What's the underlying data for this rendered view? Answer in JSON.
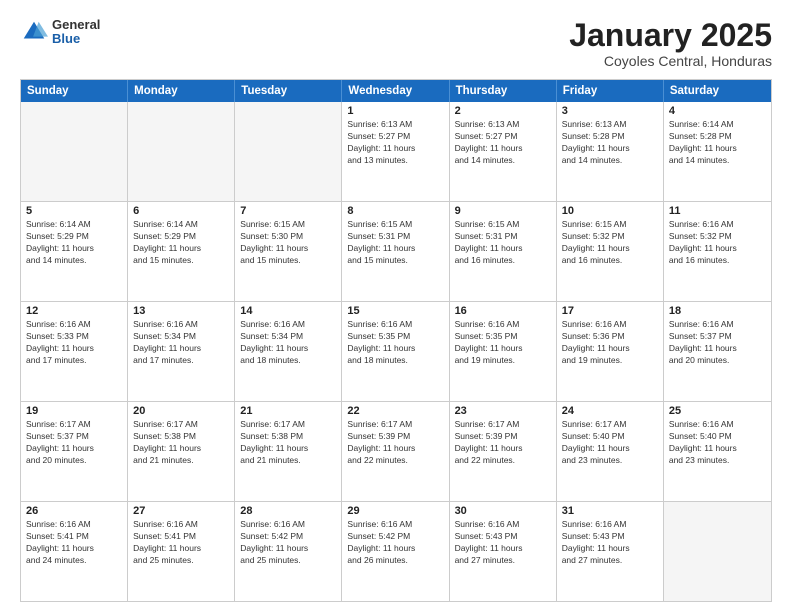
{
  "logo": {
    "general": "General",
    "blue": "Blue"
  },
  "title": "January 2025",
  "location": "Coyoles Central, Honduras",
  "days_of_week": [
    "Sunday",
    "Monday",
    "Tuesday",
    "Wednesday",
    "Thursday",
    "Friday",
    "Saturday"
  ],
  "weeks": [
    [
      {
        "day": "",
        "info": ""
      },
      {
        "day": "",
        "info": ""
      },
      {
        "day": "",
        "info": ""
      },
      {
        "day": "1",
        "info": "Sunrise: 6:13 AM\nSunset: 5:27 PM\nDaylight: 11 hours\nand 13 minutes."
      },
      {
        "day": "2",
        "info": "Sunrise: 6:13 AM\nSunset: 5:27 PM\nDaylight: 11 hours\nand 14 minutes."
      },
      {
        "day": "3",
        "info": "Sunrise: 6:13 AM\nSunset: 5:28 PM\nDaylight: 11 hours\nand 14 minutes."
      },
      {
        "day": "4",
        "info": "Sunrise: 6:14 AM\nSunset: 5:28 PM\nDaylight: 11 hours\nand 14 minutes."
      }
    ],
    [
      {
        "day": "5",
        "info": "Sunrise: 6:14 AM\nSunset: 5:29 PM\nDaylight: 11 hours\nand 14 minutes."
      },
      {
        "day": "6",
        "info": "Sunrise: 6:14 AM\nSunset: 5:29 PM\nDaylight: 11 hours\nand 15 minutes."
      },
      {
        "day": "7",
        "info": "Sunrise: 6:15 AM\nSunset: 5:30 PM\nDaylight: 11 hours\nand 15 minutes."
      },
      {
        "day": "8",
        "info": "Sunrise: 6:15 AM\nSunset: 5:31 PM\nDaylight: 11 hours\nand 15 minutes."
      },
      {
        "day": "9",
        "info": "Sunrise: 6:15 AM\nSunset: 5:31 PM\nDaylight: 11 hours\nand 16 minutes."
      },
      {
        "day": "10",
        "info": "Sunrise: 6:15 AM\nSunset: 5:32 PM\nDaylight: 11 hours\nand 16 minutes."
      },
      {
        "day": "11",
        "info": "Sunrise: 6:16 AM\nSunset: 5:32 PM\nDaylight: 11 hours\nand 16 minutes."
      }
    ],
    [
      {
        "day": "12",
        "info": "Sunrise: 6:16 AM\nSunset: 5:33 PM\nDaylight: 11 hours\nand 17 minutes."
      },
      {
        "day": "13",
        "info": "Sunrise: 6:16 AM\nSunset: 5:34 PM\nDaylight: 11 hours\nand 17 minutes."
      },
      {
        "day": "14",
        "info": "Sunrise: 6:16 AM\nSunset: 5:34 PM\nDaylight: 11 hours\nand 18 minutes."
      },
      {
        "day": "15",
        "info": "Sunrise: 6:16 AM\nSunset: 5:35 PM\nDaylight: 11 hours\nand 18 minutes."
      },
      {
        "day": "16",
        "info": "Sunrise: 6:16 AM\nSunset: 5:35 PM\nDaylight: 11 hours\nand 19 minutes."
      },
      {
        "day": "17",
        "info": "Sunrise: 6:16 AM\nSunset: 5:36 PM\nDaylight: 11 hours\nand 19 minutes."
      },
      {
        "day": "18",
        "info": "Sunrise: 6:16 AM\nSunset: 5:37 PM\nDaylight: 11 hours\nand 20 minutes."
      }
    ],
    [
      {
        "day": "19",
        "info": "Sunrise: 6:17 AM\nSunset: 5:37 PM\nDaylight: 11 hours\nand 20 minutes."
      },
      {
        "day": "20",
        "info": "Sunrise: 6:17 AM\nSunset: 5:38 PM\nDaylight: 11 hours\nand 21 minutes."
      },
      {
        "day": "21",
        "info": "Sunrise: 6:17 AM\nSunset: 5:38 PM\nDaylight: 11 hours\nand 21 minutes."
      },
      {
        "day": "22",
        "info": "Sunrise: 6:17 AM\nSunset: 5:39 PM\nDaylight: 11 hours\nand 22 minutes."
      },
      {
        "day": "23",
        "info": "Sunrise: 6:17 AM\nSunset: 5:39 PM\nDaylight: 11 hours\nand 22 minutes."
      },
      {
        "day": "24",
        "info": "Sunrise: 6:17 AM\nSunset: 5:40 PM\nDaylight: 11 hours\nand 23 minutes."
      },
      {
        "day": "25",
        "info": "Sunrise: 6:16 AM\nSunset: 5:40 PM\nDaylight: 11 hours\nand 23 minutes."
      }
    ],
    [
      {
        "day": "26",
        "info": "Sunrise: 6:16 AM\nSunset: 5:41 PM\nDaylight: 11 hours\nand 24 minutes."
      },
      {
        "day": "27",
        "info": "Sunrise: 6:16 AM\nSunset: 5:41 PM\nDaylight: 11 hours\nand 25 minutes."
      },
      {
        "day": "28",
        "info": "Sunrise: 6:16 AM\nSunset: 5:42 PM\nDaylight: 11 hours\nand 25 minutes."
      },
      {
        "day": "29",
        "info": "Sunrise: 6:16 AM\nSunset: 5:42 PM\nDaylight: 11 hours\nand 26 minutes."
      },
      {
        "day": "30",
        "info": "Sunrise: 6:16 AM\nSunset: 5:43 PM\nDaylight: 11 hours\nand 27 minutes."
      },
      {
        "day": "31",
        "info": "Sunrise: 6:16 AM\nSunset: 5:43 PM\nDaylight: 11 hours\nand 27 minutes."
      },
      {
        "day": "",
        "info": ""
      }
    ]
  ]
}
